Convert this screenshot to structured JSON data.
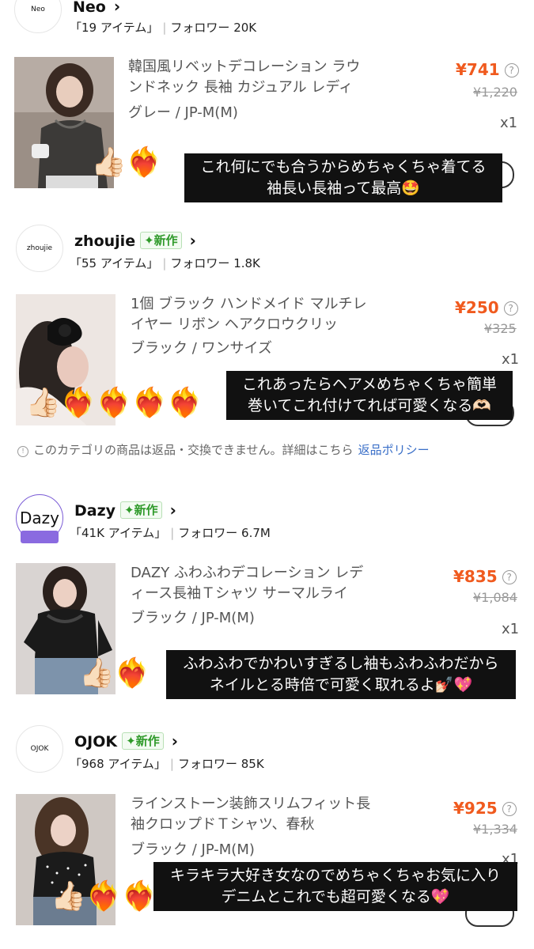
{
  "shops": [
    {
      "avatar_text": "Neo",
      "name": "Neo",
      "is_new": false,
      "items": "「19 アイテム」",
      "followers": "フォロワー 20K",
      "product": {
        "title": "韓国風リベットデコレーション ラウンドネック 長袖 カジュアル レディ",
        "variant": "グレー / JP-M(M)",
        "price": "¥741",
        "original_price": "¥1,220",
        "quantity": "x1"
      },
      "caption_lines": [
        "これ何にでも合うからめちゃくちゃ着てる",
        "袖長い長袖って最高🤩"
      ],
      "stickers": "👍🏻❤️‍🔥"
    },
    {
      "avatar_text": "zhoujie",
      "name": "zhoujie",
      "is_new": true,
      "items": "「55 アイテム」",
      "followers": "フォロワー 1.8K",
      "product": {
        "title": "1個 ブラック ハンドメイド マルチレイヤー リボン ヘアクロウクリッ",
        "variant": "ブラック / ワンサイズ",
        "price": "¥250",
        "original_price": "¥325",
        "quantity": "x1"
      },
      "caption_lines": [
        "これあったらヘアメめちゃくちゃ簡単",
        "巻いてこれ付けてれば可愛くなる🫶🏻"
      ],
      "stickers": "👍🏻❤️‍🔥❤️‍🔥❤️‍🔥❤️‍🔥"
    },
    {
      "avatar_text": "Dazy",
      "name": "Dazy",
      "is_new": true,
      "items": "「41K アイテム」",
      "followers": "フォロワー 6.7M",
      "product": {
        "title": "DAZY ふわふわデコレーション レディース長袖Ｔシャツ サーマルライ",
        "variant": "ブラック / JP-M(M)",
        "price": "¥835",
        "original_price": "¥1,084",
        "quantity": "x1"
      },
      "caption_lines": [
        "ふわふわでかわいすぎるし袖もふわふわだから",
        "ネイルとる時倍で可愛く取れるよ💅🏻💖"
      ],
      "stickers": "👍🏻❤️‍🔥"
    },
    {
      "avatar_text": "OJOK",
      "name": "OJOK",
      "is_new": true,
      "items": "「968 アイテム」",
      "followers": "フォロワー 85K",
      "product": {
        "title": "ラインストーン装飾スリムフィット長袖クロップドＴシャツ、春秋",
        "variant": "ブラック / JP-M(M)",
        "price": "¥925",
        "original_price": "¥1,334",
        "quantity": "x1"
      },
      "caption_lines": [
        "キラキラ大好き女なのでめちゃくちゃお気に入り",
        "デニムとこれでも超可愛くなる💖"
      ],
      "stickers": "👍🏻❤️‍🔥❤️‍🔥"
    }
  ],
  "new_badge": "新作",
  "return_notice": {
    "text": "このカテゴリの商品は返品・交換できません。詳細はこちら",
    "link": "返品ポリシー"
  },
  "colors": {
    "price": "#f05a1e",
    "badge_green": "#2f9a2a",
    "link_blue": "#3a6fc8"
  }
}
